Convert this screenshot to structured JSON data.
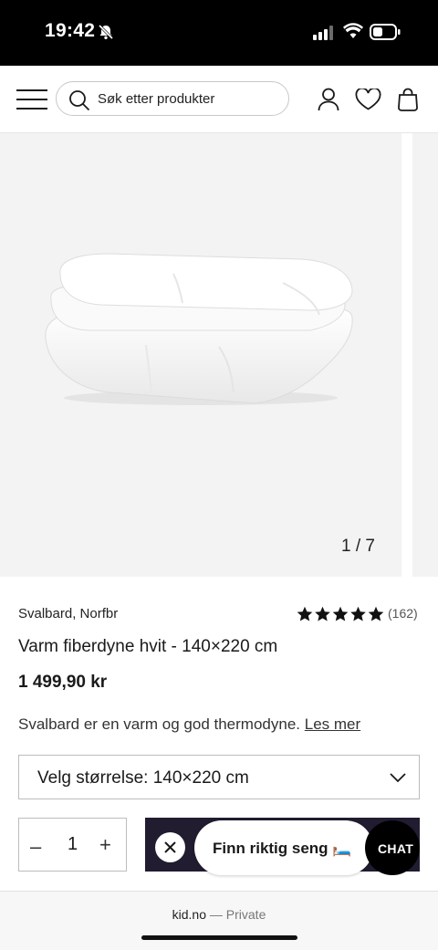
{
  "status_bar": {
    "time": "19:42"
  },
  "header": {
    "search_placeholder": "Søk etter produkter"
  },
  "gallery": {
    "counter": "1 / 7"
  },
  "product": {
    "brand": "Svalbard, Norfbr",
    "rating_stars": 5,
    "review_count": "(162)",
    "title": "Varm fiberdyne hvit - 140×220 cm",
    "price": "1 499,90 kr",
    "description": "Svalbard er en varm og god thermodyne.",
    "read_more": "Les mer"
  },
  "size_selector": {
    "label": "Velg størrelse: 140×220 cm"
  },
  "quantity": {
    "minus": "–",
    "value": "1",
    "plus": "+"
  },
  "finn_seng": {
    "label": "Finn riktig seng 🛏️"
  },
  "chat": {
    "label": "CHAT"
  },
  "browser": {
    "domain": "kid.no",
    "separator": "—",
    "mode": "Private"
  }
}
